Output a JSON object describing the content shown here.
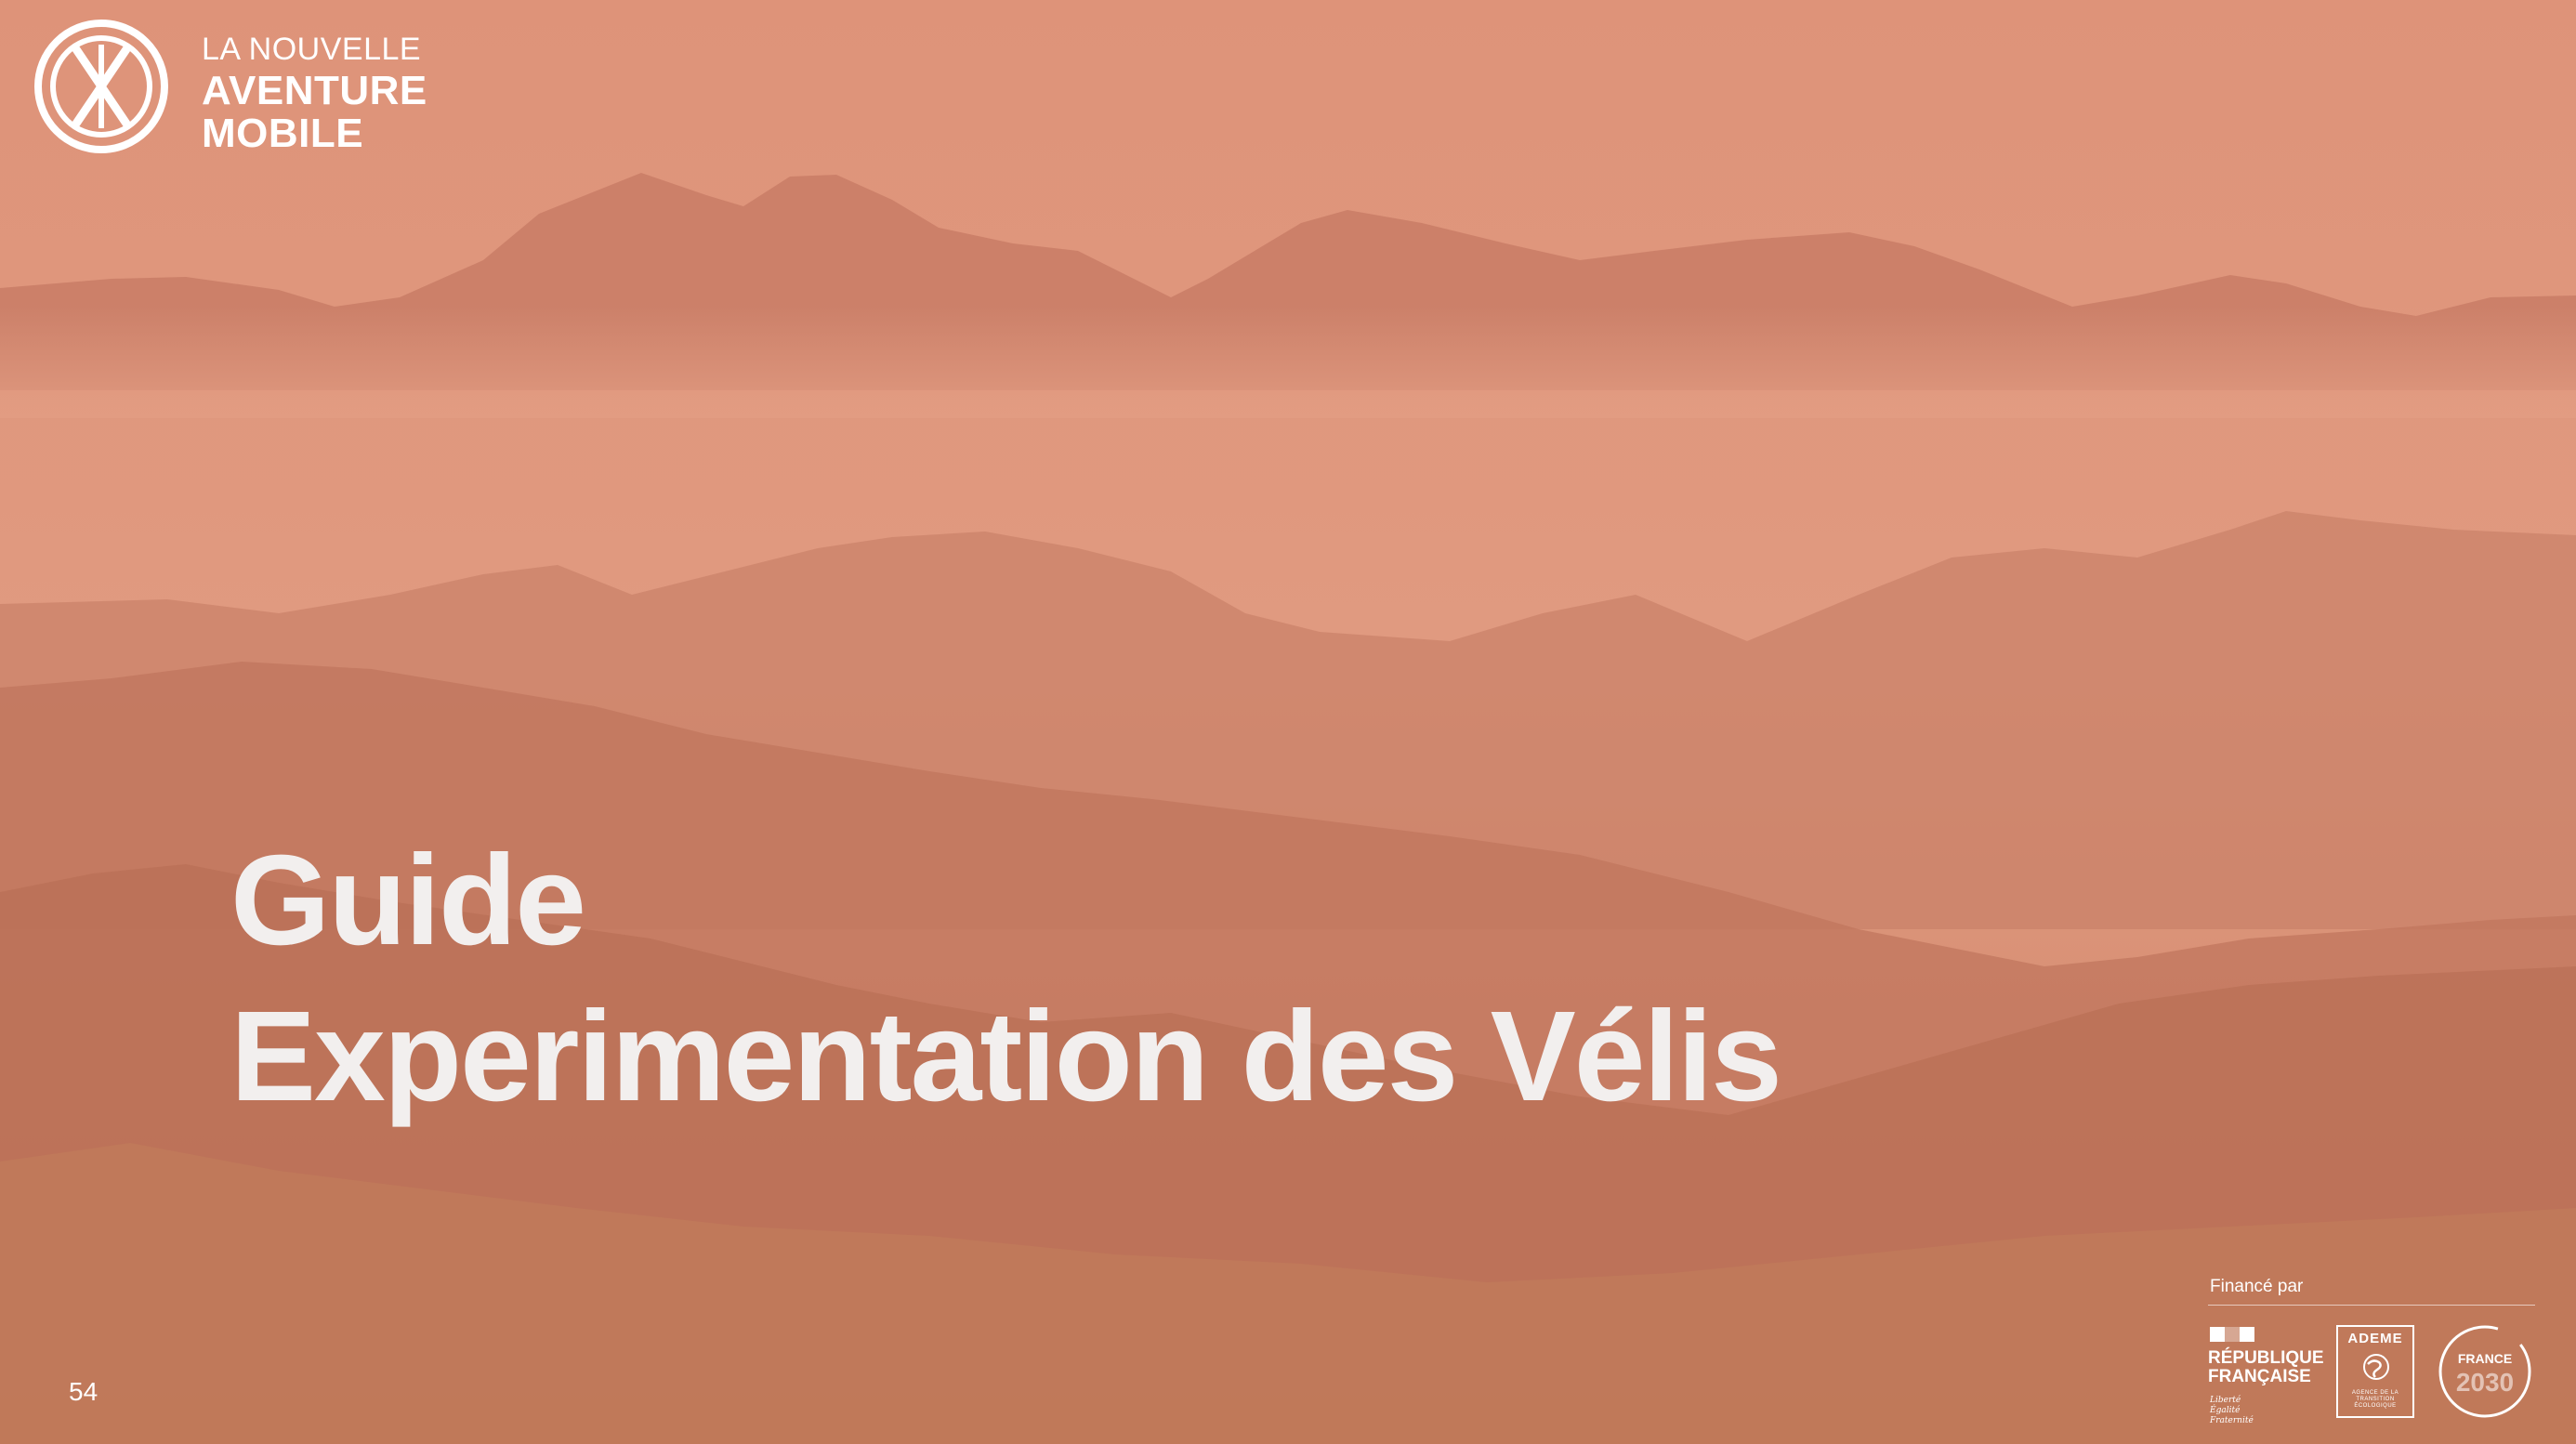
{
  "brand": {
    "name_line1": "LA NOUVELLE",
    "name_line2": "AVENTURE",
    "name_line3": "MOBILE"
  },
  "title": {
    "line1": "Guide",
    "line2": "Experimentation des Vélis"
  },
  "page_number": "54",
  "funding": {
    "label": "Financé par",
    "republique": {
      "name_line1": "RÉPUBLIQUE",
      "name_line2": "FRANÇAISE",
      "motto_line1": "Liberté",
      "motto_line2": "Égalité",
      "motto_line3": "Fraternité"
    },
    "ademe": {
      "name": "ADEME",
      "sub_line1": "AGENCE DE LA",
      "sub_line2": "TRANSITION",
      "sub_line3": "ÉCOLOGIQUE"
    },
    "france2030": {
      "label": "FRANCE",
      "year": "2030"
    }
  },
  "colors": {
    "overlay": "#d98f76",
    "text": "#f2efee"
  },
  "background": {
    "description_icon": "mountain-landscape-image"
  }
}
